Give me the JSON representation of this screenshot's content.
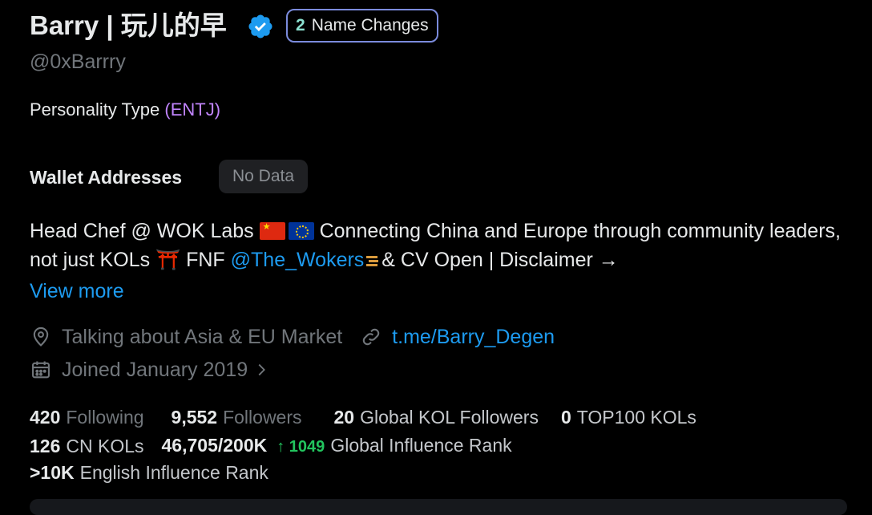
{
  "profile": {
    "display_name": "Barry | 玩儿的早",
    "handle": "@0xBarrry",
    "name_changes": {
      "count": "2",
      "label": "Name Changes"
    },
    "personality_label": "Personality Type",
    "personality_value": "(ENTJ)",
    "wallet_label": "Wallet Addresses",
    "wallet_value": "No Data",
    "bio": {
      "part1": "Head Chef @ WOK Labs",
      "part2": "Connecting China and Europe through community leaders, not just KOLs ⛩️ FNF",
      "mention": "@The_Wokers",
      "part3": "& CV Open | Disclaimer →"
    },
    "view_more": "View more",
    "location": "Talking about Asia & EU Market",
    "link": "t.me/Barry_Degen",
    "joined": "Joined January 2019"
  },
  "stats": {
    "following_count": "420",
    "following_label": "Following",
    "followers_count": "9,552",
    "followers_label": "Followers",
    "global_kol_count": "20",
    "global_kol_label": "Global KOL Followers",
    "top100_count": "0",
    "top100_label": "TOP100 KOLs",
    "cn_kol_count": "126",
    "cn_kol_label": "CN KOLs",
    "influence_value": "46,705/200K",
    "influence_change": "↑ 1049",
    "influence_label": "Global Influence Rank",
    "english_rank_value": ">10K",
    "english_rank_label": "English Influence Rank"
  },
  "colors": {
    "accent": "#1d9bf0",
    "personality": "#c084fc",
    "positive": "#22c55e",
    "badge_border": "#7b8bdc"
  }
}
